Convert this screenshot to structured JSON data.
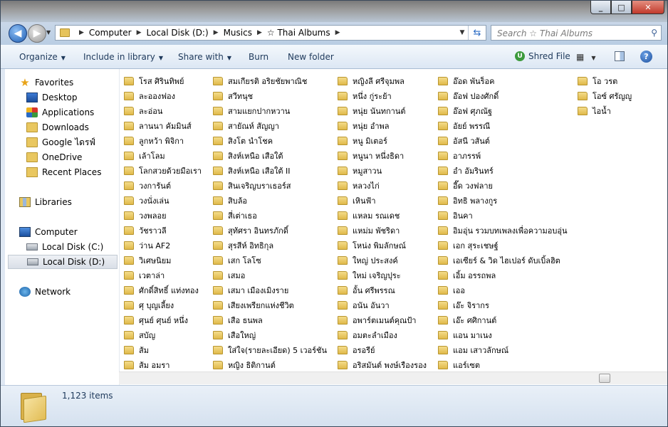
{
  "window": {
    "caption": {
      "minimize": "_",
      "maximize": "□",
      "close": "✕"
    }
  },
  "address": {
    "crumbs": [
      "Computer",
      "Local Disk (D:)",
      "Musics",
      "☆ Thai Albums"
    ],
    "search_placeholder": "Search ☆ Thai Albums"
  },
  "toolbar": {
    "organize": "Organize",
    "include_in_library": "Include in library",
    "share_with": "Share with",
    "burn": "Burn",
    "new_folder": "New folder",
    "shred_file": "Shred File"
  },
  "nav": {
    "favorites": "Favorites",
    "desktop": "Desktop",
    "applications": "Applications",
    "downloads": "Downloads",
    "google_drive": "Google ไดรฟ์",
    "onedrive": "OneDrive",
    "recent_places": "Recent Places",
    "libraries": "Libraries",
    "computer": "Computer",
    "local_disk_c": "Local Disk (C:)",
    "local_disk_d": "Local Disk (D:)",
    "network": "Network"
  },
  "folders": {
    "col1": [
      "โรส ศิรินทิพย์",
      "ละอองฟอง",
      "ละอ่อน",
      "ลานนา คัมมินส์",
      "ลูกหว้า พิจิกา",
      "เล้าโลม",
      "โลกสวยด้วยมือเรา",
      "วงการันต์",
      "วงนั่งเล่น",
      "วงพลอย",
      "วัชราวลี",
      "ว่าน AF2",
      "วิเศษนิยม",
      "เวตาล่า",
      "ศักดิ์สิทธิ์ แท่งทอง",
      "ศุ บุญเลี้ยง",
      "ศุนย์ ศุนย์ หนึ่ง",
      "สบัญ",
      "ส้ม",
      "ส้ม อมรา"
    ],
    "col2": [
      "สมเกียรติ อริยชัยพาณิช",
      "สวีทนุช",
      "สามแยกปากหวาน",
      "สายัณห์ สัญญา",
      "สิงโต นำโชค",
      "สิงห์เหนือ เสือใต้",
      "สิงห์เหนือ เสือใต้ II",
      "สินเจริญบราเธอร์ส",
      "สิบล้อ",
      "สี่เต่าเธอ",
      "สุทัศรา อินทรภักดิ์",
      "สุรสีห์ อิทธิกุล",
      "เสก โลโซ",
      "เสมอ",
      "เสมา เมืองเมิงราย",
      "เสียงเพรียกแห่งชีวิต",
      "เสือ ธนพล",
      "เสือใหญ่",
      "ใส่ใจ(รายละเอียด) 5 เวอร์ชัน",
      "หญิง ธิติกานต์"
    ],
    "col3": [
      "หญิงลี ศรีจุมพล",
      "หนึ่ง กู่ระย้า",
      "หนุ่ย นันทกานต์",
      "หนุ่ย อำพล",
      "หนู มิเตอร์",
      "หนูนา หนึ่งธิดา",
      "หมูสาวน",
      "หลวงไก่",
      "เหินฟ้า",
      "แหลม รณเดช",
      "แหม่ม พัชริดา",
      "โหน่ง พิมลักษณ์",
      "ใหญ่ ประสงค์",
      "ใหม่ เจริญปุระ",
      "อั้น ศรีพรรณ",
      "อนัน อันวา",
      "อพาร์ตเมนต์คุณป้า",
      "อมตะลำเมือง",
      "อรอรีย์",
      "อริสมันต์ พงษ์เรืองรอง"
    ],
    "col4": [
      "อ๊อด พันร็อค",
      "อ๊อฟ ปองศักดิ์",
      "อ๊อฟ ศุภณัฐ",
      "อัยย์ พรรณี",
      "อัสนี วสันต์",
      "อาภรรพ์",
      "อำ อัมรินทร์",
      "อี๊ด วงฟลาย",
      "อิทธิ พลางกูร",
      "อินคา",
      "อิมอุ่น รวมบทเพลงเพื่อความอบอุ่น",
      "เอก สุระเชษฐ์",
      "เอเซียร์ & วิด ไฮเปอร์ ดับเบิ้ลฮิต",
      "เอิ้ม อรรถพล",
      "เออ",
      "เอ๊ะ จิรากร",
      "เอ๊ะ ศศิกานต์",
      "แอน มาเนง",
      "แอม เสาวลักษณ์",
      "แอร์เซต"
    ],
    "col5": [
      "โอ วรต",
      "โอซ์ ศรัญญู",
      "ไอน้ำ"
    ]
  },
  "details": {
    "item_count": "1,123 items"
  }
}
